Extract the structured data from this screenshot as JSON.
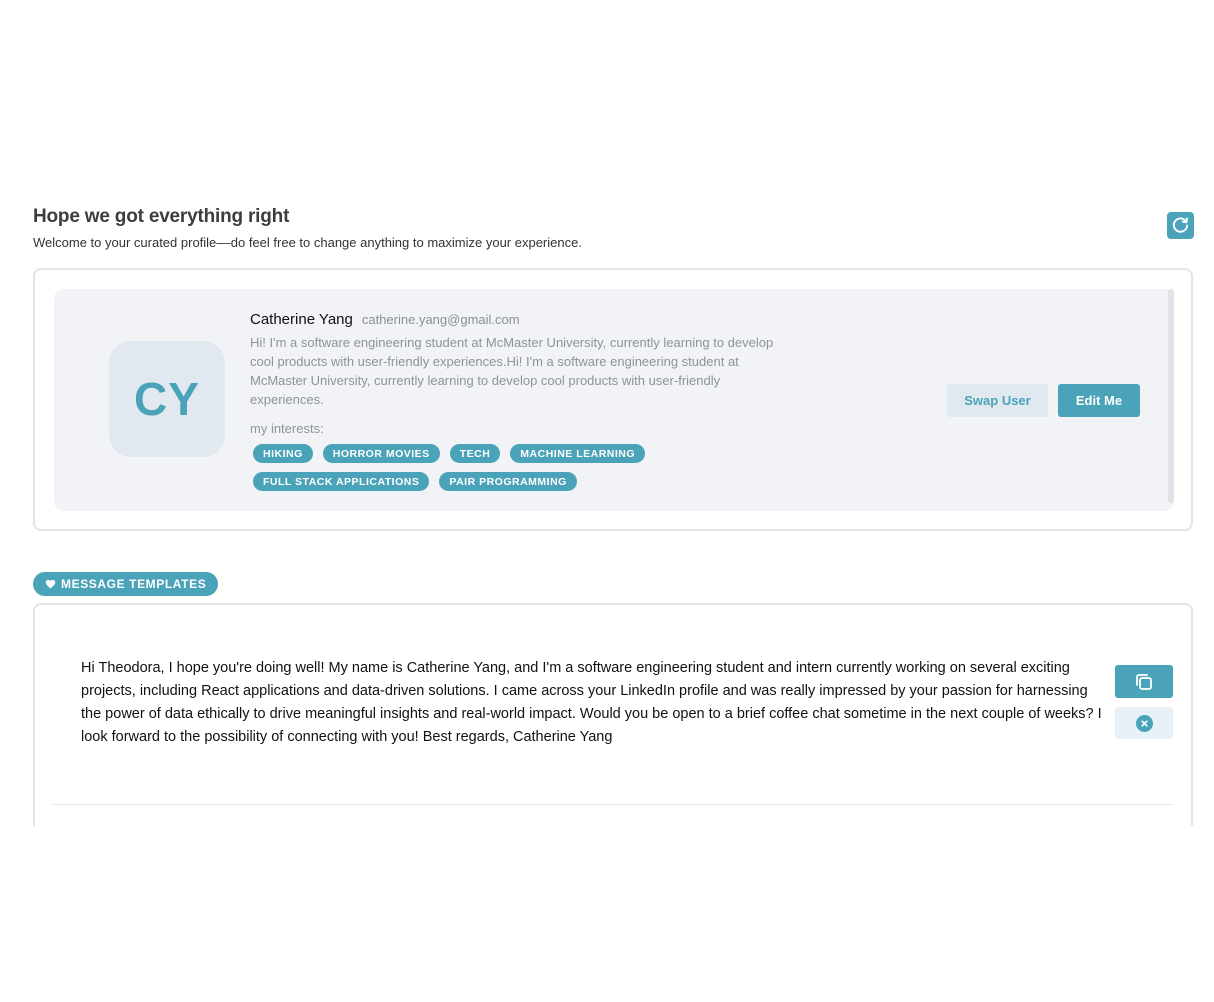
{
  "header": {
    "title": "Hope we got everything right",
    "subtitle": "Welcome to your curated profile––do feel free to change anything to maximize your experience.",
    "refresh_icon": "refresh-icon"
  },
  "profile": {
    "initials": "CY",
    "name": "Catherine Yang",
    "email": "catherine.yang@gmail.com",
    "bio": "Hi! I'm a software engineering student at McMaster University, currently learning to develop cool products with user-friendly experiences.Hi! I'm a software engineering student at McMaster University, currently learning to develop cool products with user-friendly experiences.",
    "interests_label": "my interests:",
    "interests": [
      "HIKING",
      "HORROR MOVIES",
      "TECH",
      "MACHINE LEARNING",
      "FULL STACK APPLICATIONS",
      "PAIR PROGRAMMING"
    ],
    "swap_label": "Swap User",
    "edit_label": "Edit Me"
  },
  "templates": {
    "section_label": "MESSAGE TEMPLATES",
    "section_icon": "heart-icon",
    "items": [
      {
        "text": "Hi Theodora, I hope you're doing well! My name is Catherine Yang, and I'm a software engineering student and intern currently working on several exciting projects, including React applications and data-driven solutions. I came across your LinkedIn profile and was really impressed by your passion for harnessing the power of data ethically to drive meaningful insights and real-world impact. Would you be open to a brief coffee chat sometime in the next couple of weeks? I look forward to the possibility of connecting with you! Best regards, Catherine Yang",
        "copy_icon": "copy-icon",
        "delete_icon": "close-icon"
      }
    ]
  },
  "colors": {
    "accent": "#4aa3b8",
    "card_bg": "#f1f3f6",
    "avatar_bg": "#e1e8ef",
    "muted_text": "#8e9399"
  }
}
